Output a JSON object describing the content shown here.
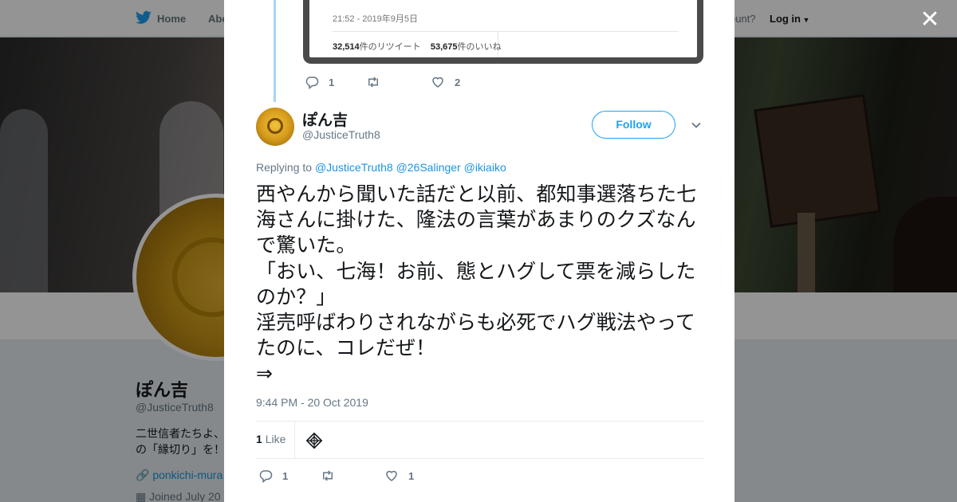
{
  "nav": {
    "home": "Home",
    "about": "Abo",
    "account_prompt": "ccount?",
    "login": "Log in"
  },
  "profile": {
    "name": "ぽん吉",
    "handle": "@JusticeTruth8",
    "bio_line1": "二世信者たちよ、",
    "bio_line2": "の「縁切り」を！",
    "link": "ponkichi-mura",
    "joined": "Joined July 20"
  },
  "parent_tweet": {
    "quoted_time": "21:52 - 2019年9月5日",
    "retweets_count": "32,514",
    "retweets_label": "件のリツイート",
    "likes_count": "53,675",
    "likes_label": "件のいいね",
    "reply_count": "1",
    "retweet_count": "",
    "like_count": "2"
  },
  "tweet": {
    "author_name": "ぽん吉",
    "author_handle": "@JusticeTruth8",
    "follow_label": "Follow",
    "replying_to_label": "Replying to",
    "mentions": [
      "@JusticeTruth8",
      "@26Salinger",
      "@ikiaiko"
    ],
    "body": "西やんから聞いた話だと以前、都知事選落ちた七海さんに掛けた、隆法の言葉があまりのクズなんで驚いた。\n「おい、七海！お前、態とハグして票を減らしたのか？」\n淫売呼ばわりされながらも必死でハグ戦法やってたのに、コレだぜ！\n⇒",
    "timestamp": "9:44 PM - 20 Oct 2019",
    "likes_count": "1",
    "likes_label": "Like",
    "reply_count": "1",
    "retweet_count": "",
    "like_count": "1"
  },
  "icons": {
    "close": "close-icon",
    "reply": "reply-icon",
    "retweet": "retweet-icon",
    "like": "heart-icon",
    "chevron": "chevron-down-icon",
    "brand": "twitter-bird-icon"
  },
  "colors": {
    "accent": "#1da1f2",
    "link": "#1b95e0",
    "muted": "#657786",
    "text": "#14171a"
  }
}
